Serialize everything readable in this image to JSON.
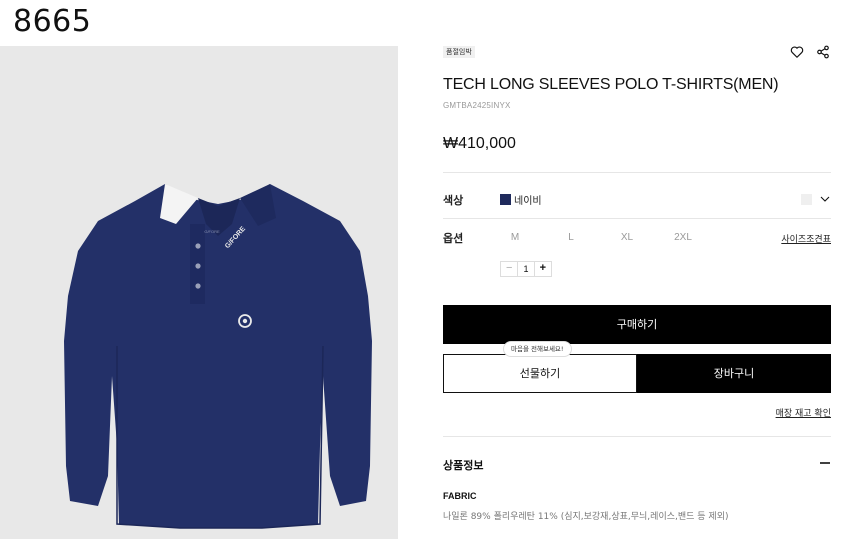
{
  "page_id": "8665",
  "product": {
    "badge": "품절임박",
    "title": "TECH LONG SLEEVES POLO T-SHIRTS(MEN)",
    "code": "GMTBA2425INYX",
    "price": "₩410,000",
    "collar_brand": "G/FORE",
    "neck_label": "G/FORE"
  },
  "icons": {
    "wishlist": "heart-icon",
    "share": "share-icon",
    "dropdown": "chevron-down-icon",
    "collapse": "minus-icon"
  },
  "color": {
    "label": "색상",
    "selected_name": "네이비",
    "selected_hex": "#1f2a5c",
    "alt_hex": "#efefef"
  },
  "option": {
    "label": "옵션",
    "sizes": [
      "M",
      "L",
      "XL",
      "2XL"
    ],
    "size_guide": "사이즈조견표"
  },
  "quantity": {
    "minus": "−",
    "value": "1",
    "plus": "+"
  },
  "actions": {
    "buy": "구매하기",
    "gift": "선물하기",
    "cart": "장바구니",
    "gift_tooltip": "마음을 전해보세요!",
    "stock_check": "매장 재고 확인"
  },
  "details": {
    "section_title": "상품정보",
    "fabric_label": "FABRIC",
    "fabric_text": "나일론 89% 폴리우레탄 11% (심지,보강재,상표,무늬,레이스,밴드 등 제외)"
  }
}
